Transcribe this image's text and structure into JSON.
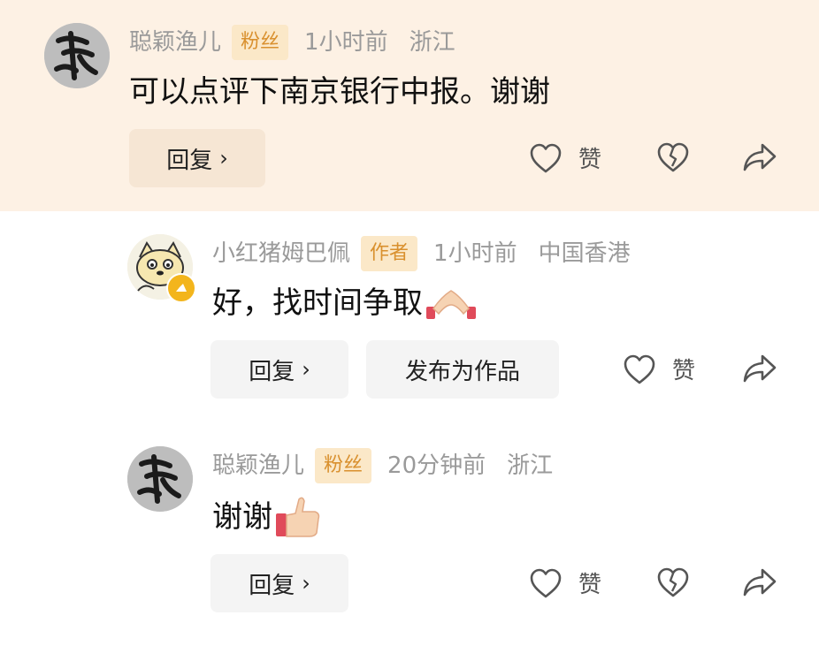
{
  "comments": [
    {
      "author": "聪颖渔儿",
      "badge": "粉丝",
      "time": "1小时前",
      "location": "浙江",
      "text": "可以点评下南京银行中报。谢谢",
      "reply_label": "回复",
      "like_label": "赞"
    },
    {
      "author": "小红猪姆巴佩",
      "badge": "作者",
      "time": "1小时前",
      "location": "中国香港",
      "text": "好，找时间争取",
      "emoji": "palms-together",
      "reply_label": "回复",
      "publish_label": "发布为作品",
      "like_label": "赞"
    },
    {
      "author": "聪颖渔儿",
      "badge": "粉丝",
      "time": "20分钟前",
      "location": "浙江",
      "text": "谢谢",
      "emoji": "thumbs-up",
      "reply_label": "回复",
      "like_label": "赞"
    }
  ],
  "colors": {
    "highlight_bg": "#fdf1e4",
    "badge_bg": "#fbe8c8",
    "badge_text": "#d9902e",
    "meta_text": "#9a9a9a"
  },
  "icons": [
    "heart-outline-icon",
    "broken-heart-icon",
    "share-arrow-icon",
    "chevron-right-icon"
  ]
}
